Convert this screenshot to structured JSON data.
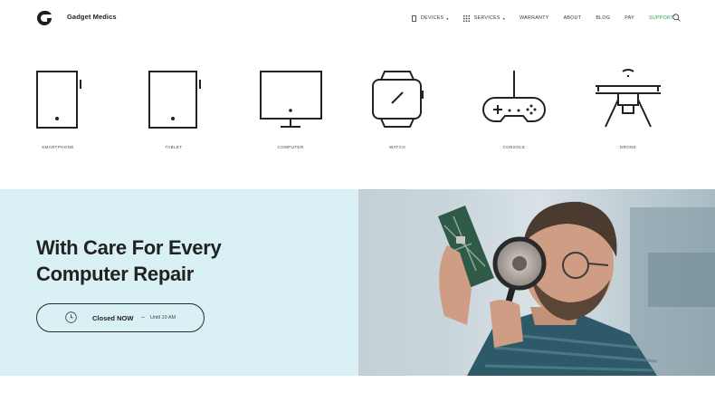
{
  "header": {
    "brand": "Gadget Medics",
    "nav": {
      "devices": "DEVICES",
      "services": "SERVICES",
      "warranty": "WARRANTY",
      "about": "ABOUT",
      "blog": "BLOG",
      "pay": "PAY",
      "support": "SUPPORT"
    },
    "icons": [
      "logo-icon",
      "phone-icon",
      "grid-icon",
      "search-icon"
    ],
    "support_color": "#2e9a4b"
  },
  "devices": [
    {
      "label": "SMARTPHONE",
      "icon": "smartphone-icon"
    },
    {
      "label": "TABLET",
      "icon": "tablet-icon"
    },
    {
      "label": "COMPUTER",
      "icon": "computer-icon"
    },
    {
      "label": "WATCH",
      "icon": "watch-icon"
    },
    {
      "label": "CONSOLE",
      "icon": "gamepad-icon"
    },
    {
      "label": "DRONE",
      "icon": "drone-icon"
    }
  ],
  "hero": {
    "title_line1": "With Care For Every",
    "title_line2": "Computer Repair",
    "hours": {
      "status": "Closed NOW",
      "separator": "–",
      "until": "Until 10 AM"
    },
    "background": "#d9f0f4"
  }
}
